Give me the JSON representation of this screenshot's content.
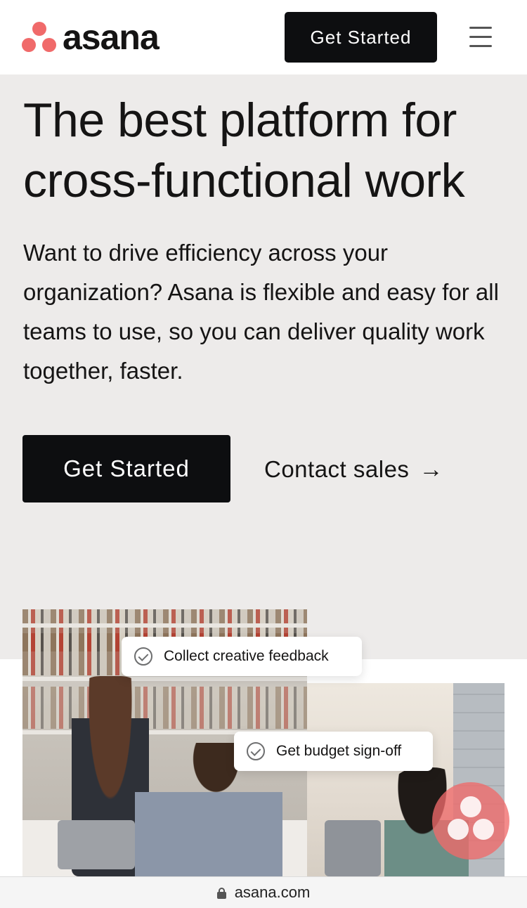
{
  "header": {
    "logo_text": "asana",
    "get_started_label": "Get Started",
    "menu_icon": "hamburger-menu-icon"
  },
  "hero": {
    "title_line1": "The best platform for",
    "title_line2": "cross-functional work",
    "subtitle": "Want to drive efficiency across your organization? Asana is flexible and easy for all teams to use, so you can deliver quality work together, faster.",
    "primary_cta": "Get Started",
    "secondary_cta": "Contact sales",
    "secondary_cta_arrow": "→"
  },
  "media": {
    "chip_1": "Collect creative feedback",
    "chip_2": "Get budget sign-off"
  },
  "browser": {
    "url": "asana.com"
  },
  "colors": {
    "brand_coral": "#f06a6a",
    "button_black": "#0d0e10",
    "hero_bg": "#edebea"
  }
}
